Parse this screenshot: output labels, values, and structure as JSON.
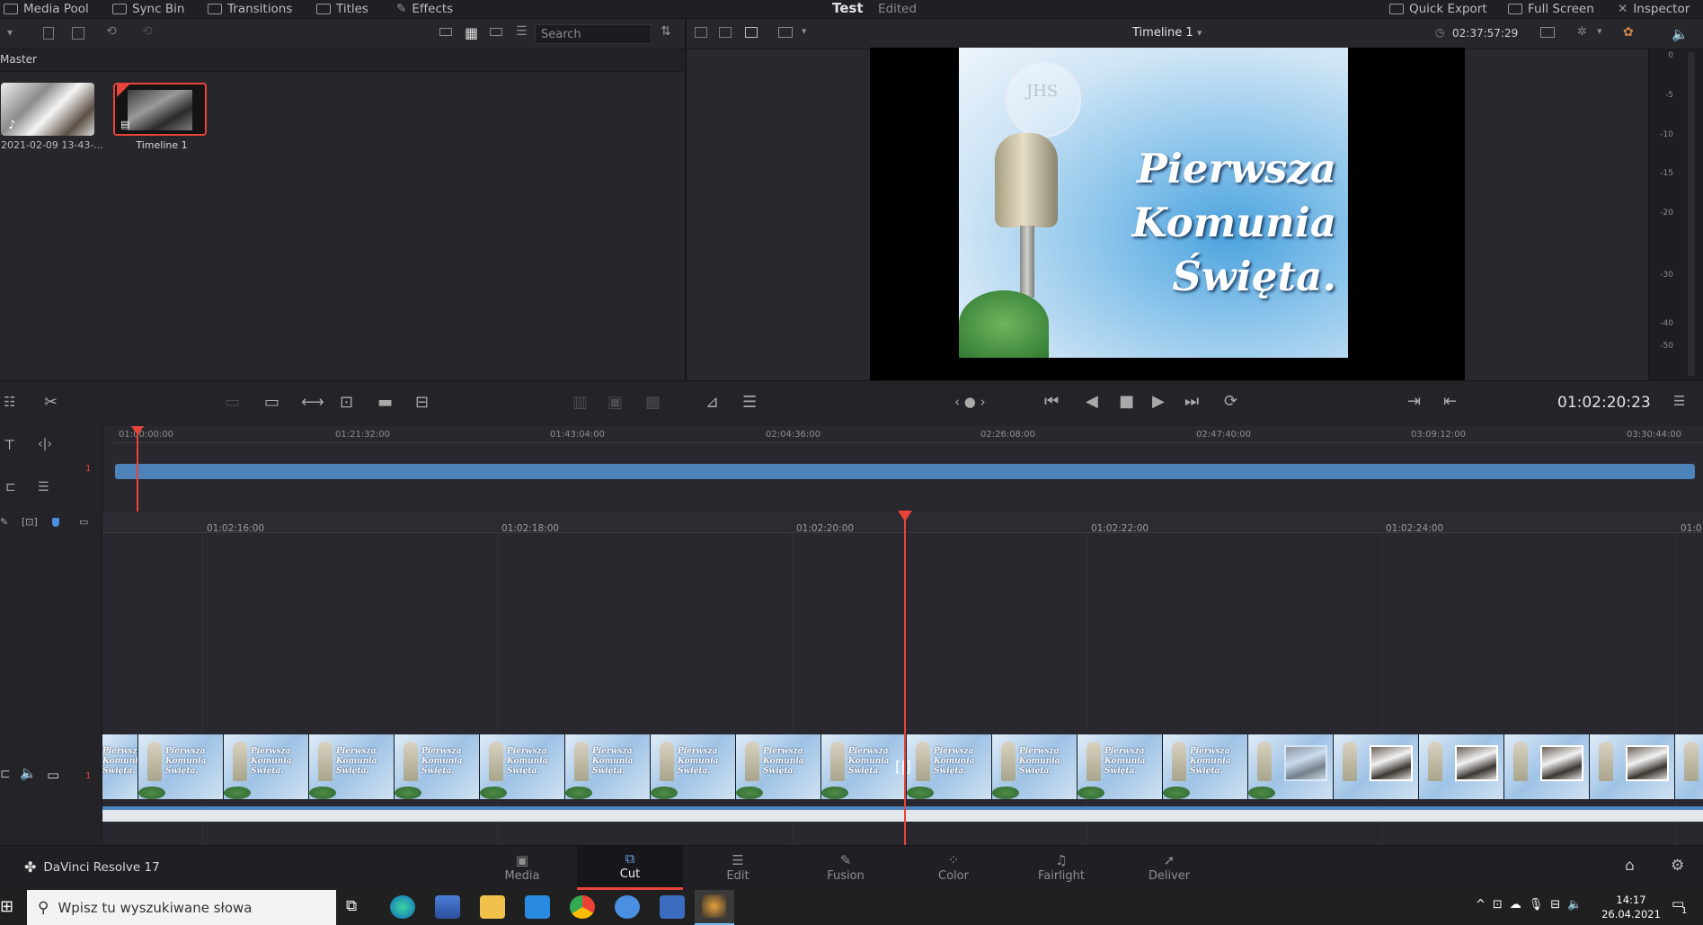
{
  "topbar": {
    "media_pool": "Media Pool",
    "sync_bin": "Sync Bin",
    "transitions": "Transitions",
    "titles": "Titles",
    "effects": "Effects",
    "project_title": "Test",
    "project_status": "Edited",
    "quick_export": "Quick Export",
    "full_screen": "Full Screen",
    "inspector": "Inspector"
  },
  "media_pool": {
    "search_placeholder": "Search",
    "bin_name": "Master",
    "clips": [
      {
        "name": "2021-02-09 13-43-...",
        "icon": "audio-note-icon"
      },
      {
        "name": "Timeline 1",
        "icon": "timeline-icon",
        "selected": true
      }
    ]
  },
  "viewer": {
    "timeline_name": "Timeline 1",
    "duration": "02:37:57:29",
    "timecode": "01:02:20:23",
    "video_text": [
      "Pierwsza",
      "Komunia",
      "Święta."
    ],
    "meter_scale": [
      "0",
      "-5",
      "-10",
      "-15",
      "-20",
      "-30",
      "-40",
      "-50"
    ]
  },
  "upper_ruler": [
    "01:00:00:00",
    "01:21:32:00",
    "01:43:04:00",
    "02:04:36:00",
    "02:26:08:00",
    "02:47:40:00",
    "03:09:12:00",
    "03:30:44:00"
  ],
  "lower_ruler": [
    "01:02:16:00",
    "01:02:18:00",
    "01:02:20:00",
    "01:02:22:00",
    "01:02:24:00",
    "01:0"
  ],
  "track_number": "1",
  "pages": {
    "app_name": "DaVinci Resolve 17",
    "tabs": [
      {
        "label": "Media",
        "icon": "media-icon"
      },
      {
        "label": "Cut",
        "icon": "cut-icon",
        "active": true
      },
      {
        "label": "Edit",
        "icon": "edit-icon"
      },
      {
        "label": "Fusion",
        "icon": "fusion-icon"
      },
      {
        "label": "Color",
        "icon": "color-icon"
      },
      {
        "label": "Fairlight",
        "icon": "fairlight-icon"
      },
      {
        "label": "Deliver",
        "icon": "deliver-icon"
      }
    ]
  },
  "taskbar": {
    "search_placeholder": "Wpisz tu wyszukiwane słowa",
    "time": "14:17",
    "date": "26.04.2021",
    "notification_count": "1"
  },
  "colors": {
    "accent": "#e8443a",
    "track_blue": "#4d83b9",
    "panel": "#28282e"
  }
}
